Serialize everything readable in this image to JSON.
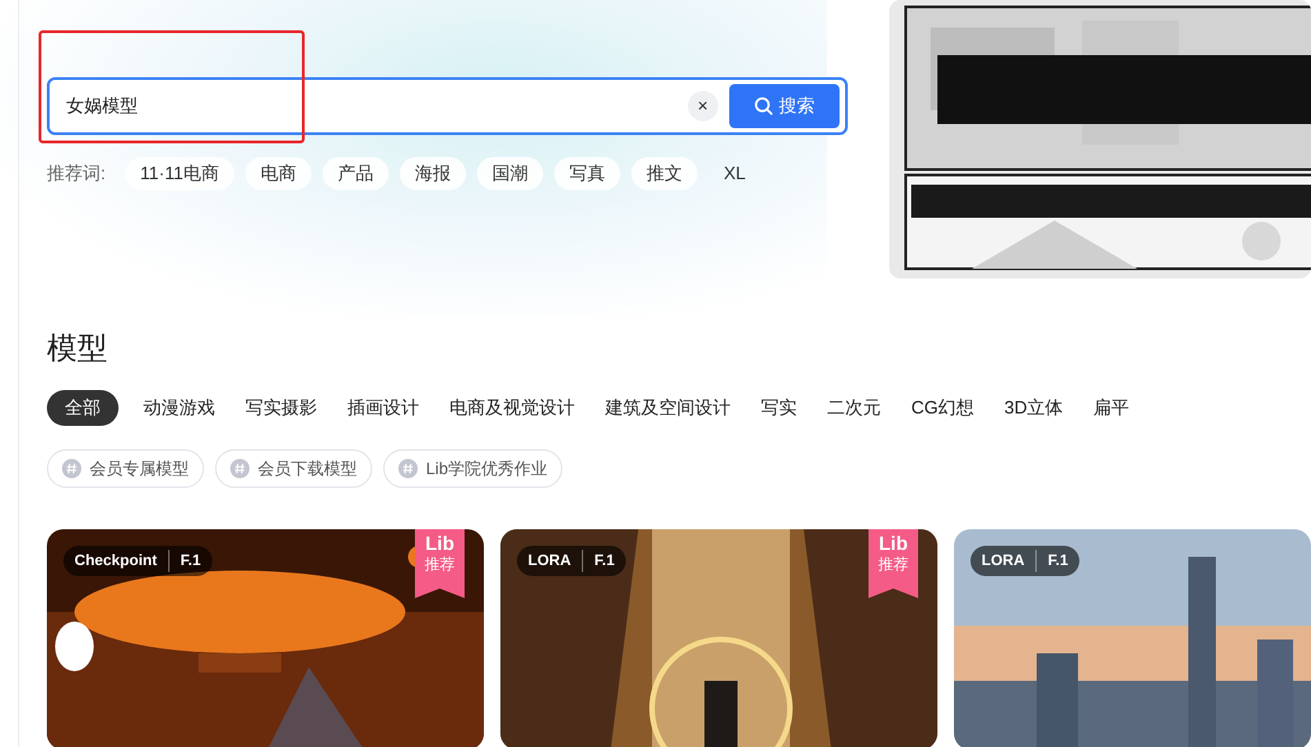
{
  "search": {
    "value": "女娲模型",
    "button": "搜索",
    "clear": "×"
  },
  "suggest_label": "推荐词:",
  "suggestions": [
    "11·11电商",
    "电商",
    "产品",
    "海报",
    "国潮",
    "写真",
    "推文",
    "XL"
  ],
  "section_title": "模型",
  "categories": [
    {
      "label": "全部",
      "selected": true
    },
    {
      "label": "动漫游戏",
      "selected": false
    },
    {
      "label": "写实摄影",
      "selected": false
    },
    {
      "label": "插画设计",
      "selected": false
    },
    {
      "label": "电商及视觉设计",
      "selected": false
    },
    {
      "label": "建筑及空间设计",
      "selected": false
    },
    {
      "label": "写实",
      "selected": false
    },
    {
      "label": "二次元",
      "selected": false
    },
    {
      "label": "CG幻想",
      "selected": false
    },
    {
      "label": "3D立体",
      "selected": false
    },
    {
      "label": "扁平",
      "selected": false
    }
  ],
  "tags": [
    "会员专属模型",
    "会员下载模型",
    "Lib学院优秀作业"
  ],
  "cards": [
    {
      "type": "Checkpoint",
      "base": "F.1",
      "recommended": true,
      "ribbon": [
        "Lib",
        "推荐"
      ],
      "kind": "picture"
    },
    {
      "type": "LORA",
      "base": "F.1",
      "recommended": true,
      "ribbon": [
        "Lib",
        "推荐"
      ],
      "kind": "picture"
    },
    {
      "type": "LORA",
      "base": "F.1",
      "recommended": false,
      "kind": "picture"
    }
  ]
}
